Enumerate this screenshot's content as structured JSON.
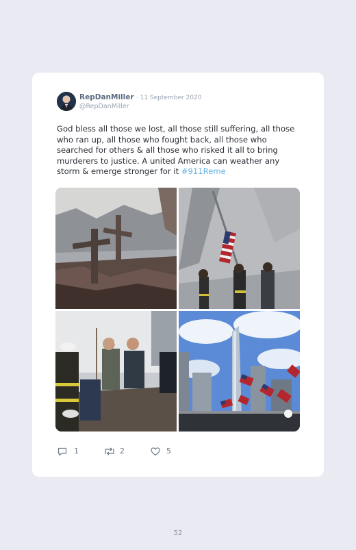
{
  "tweet": {
    "username": "RepDanMiller",
    "date": "· 11 September 2020",
    "handle": "@RepDanMiller",
    "text": "God bless all those we lost, all those still suffering, all those who ran up, all those who fought back, all those who searched for others & all those who risked it all to bring murderers to justice. A united America can weather any storm & emerge stronger for it ",
    "hashtag": "#911Reme",
    "replies": "1",
    "retweets": "2",
    "likes": "5"
  },
  "page": {
    "number": "52"
  },
  "icons": [
    "reply-icon",
    "retweet-icon",
    "heart-icon"
  ],
  "colors": {
    "hashtag": "#62b2e6",
    "background": "#e9eaf2",
    "card": "#ffffff"
  }
}
